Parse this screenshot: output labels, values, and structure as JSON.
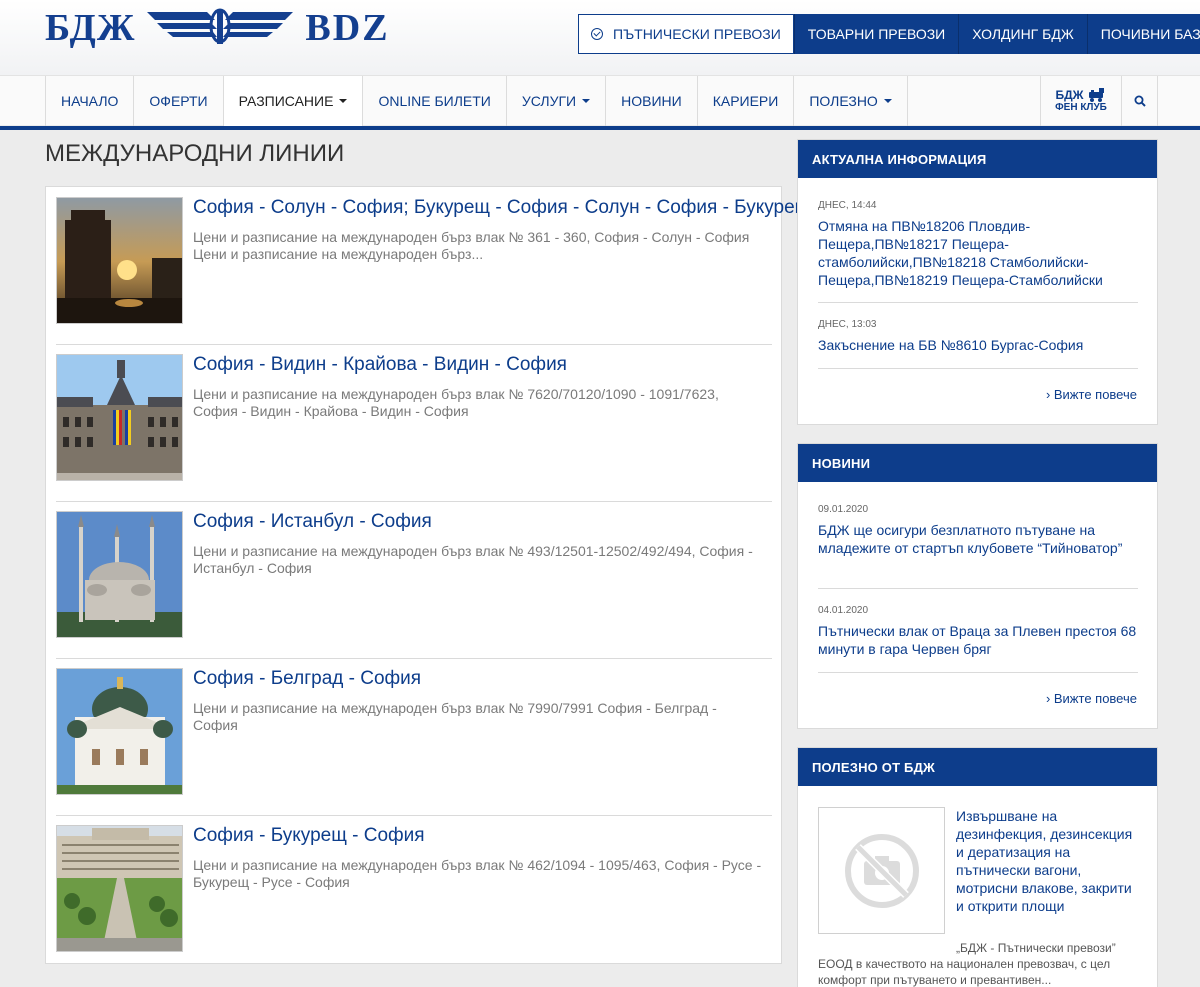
{
  "header": {
    "logo_bg": "БДЖ",
    "logo_en": "BDZ",
    "top_nav": [
      {
        "label": "ПЪТНИЧЕСКИ ПРЕВОЗИ",
        "active": true
      },
      {
        "label": "ТОВАРНИ ПРЕВОЗИ"
      },
      {
        "label": "ХОЛДИНГ БДЖ"
      },
      {
        "label": "ПОЧИВНИ БАЗИ"
      }
    ],
    "main_menu": [
      {
        "label": "НАЧАЛО"
      },
      {
        "label": "ОФЕРТИ"
      },
      {
        "label": "РАЗПИСАНИЕ",
        "dropdown": true,
        "active": true
      },
      {
        "label": "ONLINE БИЛЕТИ"
      },
      {
        "label": "УСЛУГИ",
        "dropdown": true
      },
      {
        "label": "НОВИНИ"
      },
      {
        "label": "КАРИЕРИ"
      },
      {
        "label": "ПОЛЕЗНО",
        "dropdown": true
      }
    ],
    "fan_club": {
      "line1": "БДЖ",
      "line2": "ФЕН КЛУБ"
    },
    "search_icon": "search-icon"
  },
  "main": {
    "title": "МЕЖДУНАРОДНИ ЛИНИИ",
    "lines": [
      {
        "title": "София - Солун - София; Букурещ - София - Солун - София - Букурещ",
        "desc": "Цени и разписание на международен бърз влак № 361 - 360, София - Солун - София Цени и разписание на международен бърз..."
      },
      {
        "title": "София - Видин - Крайова - Видин - София",
        "desc": "Цени и разписание на международен бърз влак № 7620/70120/1090 - 1091/7623, София - Видин - Крайова - Видин - София"
      },
      {
        "title": "София - Истанбул - София",
        "desc": "Цени и разписание на международен бърз влак № 493/12501-12502/492/494, София - Истанбул - София"
      },
      {
        "title": "София - Белград - София",
        "desc": "Цени и разписание на международен бърз влак № 7990/7991 София - Белград - София"
      },
      {
        "title": "София - Букурещ - София",
        "desc": "Цени и разписание на международен бърз влак № 462/1094 - 1095/463, София - Русе - Букурещ - Русе - София"
      }
    ]
  },
  "sidebar": {
    "current_info": {
      "heading": "АКТУАЛНА ИНФОРМАЦИЯ",
      "items": [
        {
          "date": "ДНЕС, 14:44",
          "text": "Отмяна на ПВ№18206 Пловдив-Пещера,ПВ№18217 Пещера-стамболийски,ПВ№18218 Стамболийски-Пещера,ПВ№18219 Пещера-Стамболийски"
        },
        {
          "date": "ДНЕС, 13:03",
          "text": "Закъснение на БВ №8610 Бургас-София"
        }
      ],
      "more": "› Вижте повече"
    },
    "news": {
      "heading": "НОВИНИ",
      "items": [
        {
          "date": "09.01.2020",
          "text": "БДЖ ще осигури безплатното пътуване на младежите от стартъп клубовете “Тийноватор”"
        },
        {
          "date": "04.01.2020",
          "text": "Пътнически влак от Враца за Плевен престоя 68 минути в гара Червен бряг"
        }
      ],
      "more": "› Вижте повече"
    },
    "useful": {
      "heading": "ПОЛЕЗНО ОТ БДЖ",
      "title": "Извършване на дезинфекция, дезинсекция и дератизация на пътнически вагони, мотрисни влакове, закрити и открити площи",
      "desc": "„БДЖ - Пътнически превози” ЕООД в качеството на национален превозвач, с цел комфорт при пътуването и превантивен..."
    }
  },
  "colors": {
    "brand": "#0d3d8b",
    "background": "#ececec"
  }
}
